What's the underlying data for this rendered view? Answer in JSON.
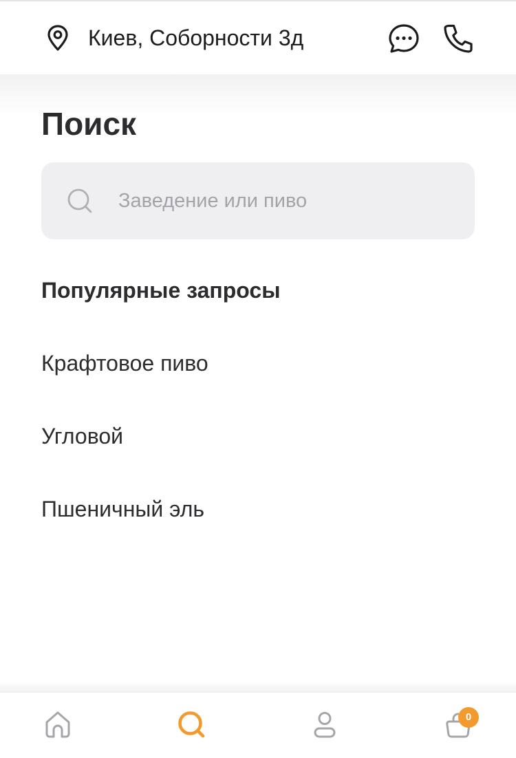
{
  "header": {
    "location_icon": "map-pin-icon",
    "location": "Киев, Соборности 3д",
    "chat_icon": "chat-bubble-icon",
    "phone_icon": "phone-icon"
  },
  "main": {
    "title": "Поиск",
    "search": {
      "icon": "search-icon",
      "placeholder": "Заведение или пиво",
      "value": ""
    },
    "popular": {
      "title": "Популярные запросы",
      "items": [
        "Крафтовое пиво",
        "Угловой",
        "Пшеничный эль"
      ]
    }
  },
  "tabbar": {
    "items": [
      {
        "icon": "home-icon",
        "active": false
      },
      {
        "icon": "search-icon",
        "active": true
      },
      {
        "icon": "profile-icon",
        "active": false
      },
      {
        "icon": "cart-icon",
        "active": false
      }
    ],
    "cart_badge": "0"
  },
  "colors": {
    "accent": "#f29a2e",
    "text": "#2c2c2e",
    "muted_icon": "#a6a6aa",
    "search_bg": "#efeff1",
    "placeholder": "#a3a3a8"
  }
}
